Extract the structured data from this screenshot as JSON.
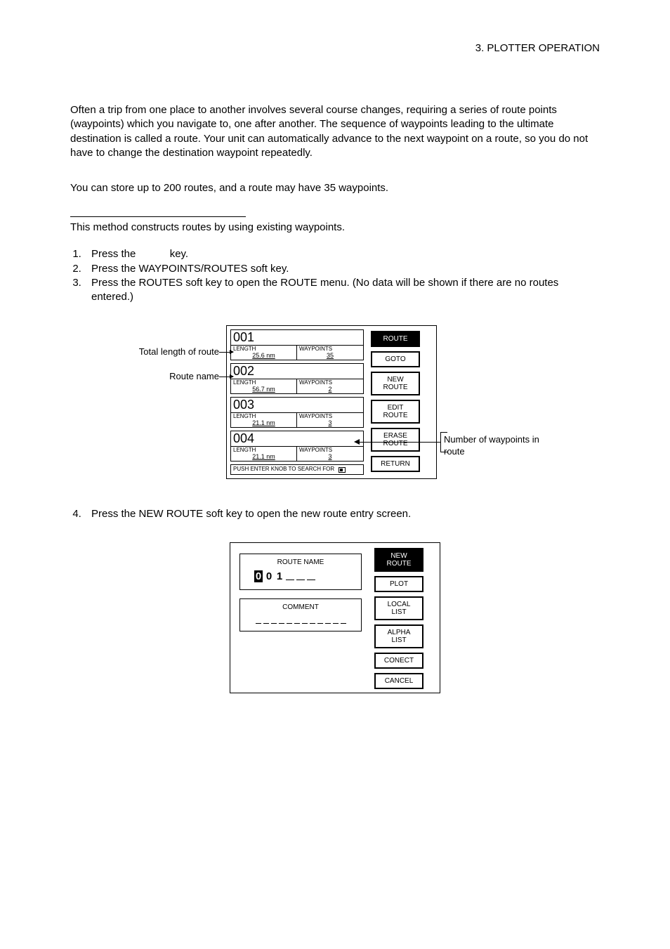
{
  "header": {
    "section_label": "3.  PLOTTER  OPERATION"
  },
  "intro_paragraphs": [
    "Often a trip from one place to another involves several course changes, requiring a series of route points (waypoints) which you navigate to, one after another. The sequence of waypoints leading to the ultimate destination is called a route. Your unit can automatically advance to the next waypoint on a route, so you do not have to change the destination waypoint repeatedly.",
    "You can store up to 200 routes, and a route may have 35 waypoints."
  ],
  "sub_caption": "This method constructs routes by using existing waypoints.",
  "steps_a": [
    {
      "prefix": "Press the ",
      "mid": "",
      "suffix": " key."
    },
    {
      "full": "Press the WAYPOINTS/ROUTES soft key."
    },
    {
      "full": "Press the ROUTES soft key to open the ROUTE menu. (No data will be shown if there are no routes entered.)"
    }
  ],
  "route_list": {
    "left_labels": {
      "total_length": "Total length of route",
      "route_name": "Route name"
    },
    "right_label": "Number of waypoints in route",
    "routes": [
      {
        "id": "001",
        "length_label": "LENGTH",
        "length": "25.6 nm",
        "wp_label": "WAYPOINTS",
        "wp": "35"
      },
      {
        "id": "002",
        "length_label": "LENGTH",
        "length": "56.7 nm",
        "wp_label": "WAYPOINTS",
        "wp": "2"
      },
      {
        "id": "003",
        "length_label": "LENGTH",
        "length": "21.1 nm",
        "wp_label": "WAYPOINTS",
        "wp": "3"
      },
      {
        "id": "004",
        "length_label": "LENGTH",
        "length": "21.1 nm",
        "wp_label": "WAYPOINTS",
        "wp": "3"
      }
    ],
    "search_hint": "PUSH ENTER KNOB TO SEARCH FOR",
    "softkeys": [
      {
        "label": "ROUTE",
        "active": true
      },
      {
        "label": "GOTO",
        "active": false
      },
      {
        "label": "NEW\nROUTE",
        "active": false
      },
      {
        "label": "EDIT\nROUTE",
        "active": false
      },
      {
        "label": "ERASE\nROUTE",
        "active": false
      },
      {
        "label": "RETURN",
        "active": false
      }
    ]
  },
  "step4": "Press the NEW ROUTE soft key to open the new route entry screen.",
  "new_route": {
    "name_label": "ROUTE NAME",
    "name_chars": [
      "0",
      "0",
      "1",
      " ",
      " ",
      " "
    ],
    "comment_label": "COMMENT",
    "dash_count": 12,
    "softkeys": [
      {
        "label": "NEW\nROUTE",
        "active": true
      },
      {
        "label": "PLOT",
        "active": false
      },
      {
        "label": "LOCAL\nLIST",
        "active": false
      },
      {
        "label": "ALPHA\nLIST",
        "active": false
      },
      {
        "label": "CONECT",
        "active": false
      },
      {
        "label": "CANCEL",
        "active": false
      }
    ]
  }
}
